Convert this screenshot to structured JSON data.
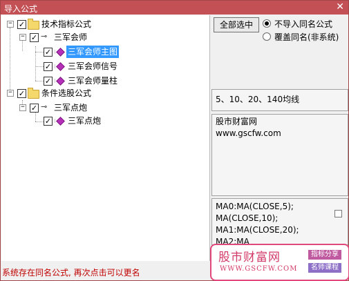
{
  "window": {
    "title": "导入公式",
    "close_glyph": "✕"
  },
  "tree": {
    "group1": {
      "label": "技术指标公式",
      "expander": "−",
      "checked": "✓"
    },
    "author1": {
      "label": "三军会师",
      "expander": "−",
      "checked": "✓",
      "icon": "key-icon"
    },
    "items1": [
      {
        "label": "三军会师主图",
        "checked": "✓",
        "selected": true
      },
      {
        "label": "三军会师信号",
        "checked": "✓"
      },
      {
        "label": "三军会师量柱",
        "checked": "✓"
      }
    ],
    "group2": {
      "label": "条件选股公式",
      "expander": "−",
      "checked": "✓"
    },
    "author2": {
      "label": "三军点炮",
      "expander": "−",
      "checked": "✓",
      "icon": "key-icon"
    },
    "items2": [
      {
        "label": "三军点炮",
        "checked": "✓"
      }
    ]
  },
  "right": {
    "select_all_label": "全部选中",
    "radio1_label": "不导入同名公式",
    "radio2_label": "覆盖同名(非系统)",
    "desc": "5、10、20、140均线",
    "site_name": "股市财富网",
    "site_url": "www.gscfw.com",
    "code": "MA0:MA(CLOSE,5);\nMA(CLOSE,10);\nMA1:MA(CLOSE,20);\nMA2:MA"
  },
  "status": {
    "text": "系统存在同名公式, 再次点击可以更名"
  },
  "watermark": {
    "brand": "股市财富网",
    "url": "WWW.GSCFW.COM",
    "tag1": "指标分享",
    "tag2": "名师课程"
  },
  "colors": {
    "titlebar": "#c25054",
    "selection": "#3399ff",
    "status": "#c00000",
    "watermark": "#e0477a"
  }
}
